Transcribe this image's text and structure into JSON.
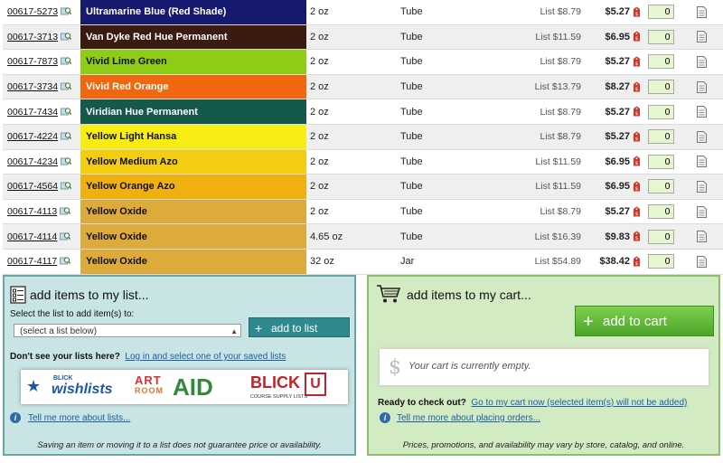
{
  "rows": [
    {
      "item": "00617-5273",
      "color_name": "Ultramarine Blue (Red Shade)",
      "swatch": "#161a6e",
      "text_color": "#ffffff",
      "size": "2 oz",
      "form": "Tube",
      "list": "List $8.79",
      "price": "$5.27",
      "qty": "0"
    },
    {
      "item": "00617-3713",
      "color_name": "Van Dyke Red Hue Permanent",
      "swatch": "#3b1a10",
      "text_color": "#ffffff",
      "size": "2 oz",
      "form": "Tube",
      "list": "List $11.59",
      "price": "$6.95",
      "qty": "0"
    },
    {
      "item": "00617-7873",
      "color_name": "Vivid Lime Green",
      "swatch": "#8fcc15",
      "text_color": "#111111",
      "size": "2 oz",
      "form": "Tube",
      "list": "List $8.79",
      "price": "$5.27",
      "qty": "0"
    },
    {
      "item": "00617-3734",
      "color_name": "Vivid Red Orange",
      "swatch": "#f0670f",
      "text_color": "#ffffff",
      "size": "2 oz",
      "form": "Tube",
      "list": "List $13.79",
      "price": "$8.27",
      "qty": "0"
    },
    {
      "item": "00617-7434",
      "color_name": "Viridian Hue Permanent",
      "swatch": "#14594a",
      "text_color": "#ffffff",
      "size": "2 oz",
      "form": "Tube",
      "list": "List $8.79",
      "price": "$5.27",
      "qty": "0"
    },
    {
      "item": "00617-4224",
      "color_name": "Yellow Light Hansa",
      "swatch": "#f7ec13",
      "text_color": "#111111",
      "size": "2 oz",
      "form": "Tube",
      "list": "List $8.79",
      "price": "$5.27",
      "qty": "0"
    },
    {
      "item": "00617-4234",
      "color_name": "Yellow Medium Azo",
      "swatch": "#f3cc14",
      "text_color": "#111111",
      "size": "2 oz",
      "form": "Tube",
      "list": "List $11.59",
      "price": "$6.95",
      "qty": "0"
    },
    {
      "item": "00617-4564",
      "color_name": "Yellow Orange Azo",
      "swatch": "#efb010",
      "text_color": "#111111",
      "size": "2 oz",
      "form": "Tube",
      "list": "List $11.59",
      "price": "$6.95",
      "qty": "0"
    },
    {
      "item": "00617-4113",
      "color_name": "Yellow Oxide",
      "swatch": "#ddaa3c",
      "text_color": "#111111",
      "size": "2 oz",
      "form": "Tube",
      "list": "List $8.79",
      "price": "$5.27",
      "qty": "0"
    },
    {
      "item": "00617-4114",
      "color_name": "Yellow Oxide",
      "swatch": "#ddaa3c",
      "text_color": "#111111",
      "size": "4.65 oz",
      "form": "Tube",
      "list": "List $16.39",
      "price": "$9.83",
      "qty": "0"
    },
    {
      "item": "00617-4117",
      "color_name": "Yellow Oxide",
      "swatch": "#ddaa3c",
      "text_color": "#111111",
      "size": "32 oz",
      "form": "Jar",
      "list": "List $54.89",
      "price": "$38.42",
      "qty": "0"
    }
  ],
  "list_panel": {
    "title": "add items to my list...",
    "select_label": "Select the list to add item(s) to:",
    "select_value": "(select a list below)",
    "add_button": "add to list",
    "prompt": "Don't see your lists here?",
    "login_link": "Log in and select one of your saved lists",
    "logos": {
      "blick_small": "BLICK",
      "wishlists": "wishlists",
      "art": "ART",
      "room": "ROOM",
      "aid": "AID",
      "blick_u": "BLICK",
      "u": "U",
      "course": "COURSE SUPPLY LISTS"
    },
    "tell_more": "Tell me more about lists...",
    "disclaimer": "Saving an item or moving it to a list does not guarantee price or availability."
  },
  "cart_panel": {
    "title": "add items to my cart...",
    "add_button": "add to cart",
    "empty_message": "Your cart is currently empty.",
    "checkout_label": "Ready to check out?",
    "checkout_link": "Go to my cart now (selected item(s) will not be added)",
    "tell_more": "Tell me more about placing orders...",
    "disclaimer": "Prices, promotions, and availability may vary by store, catalog, and online."
  },
  "colors": {
    "list_panel_bg": "#c8e4e4",
    "cart_panel_bg": "#d3ebc3",
    "link": "#1c5ea8",
    "qty_bg": "#e6f6d0"
  }
}
